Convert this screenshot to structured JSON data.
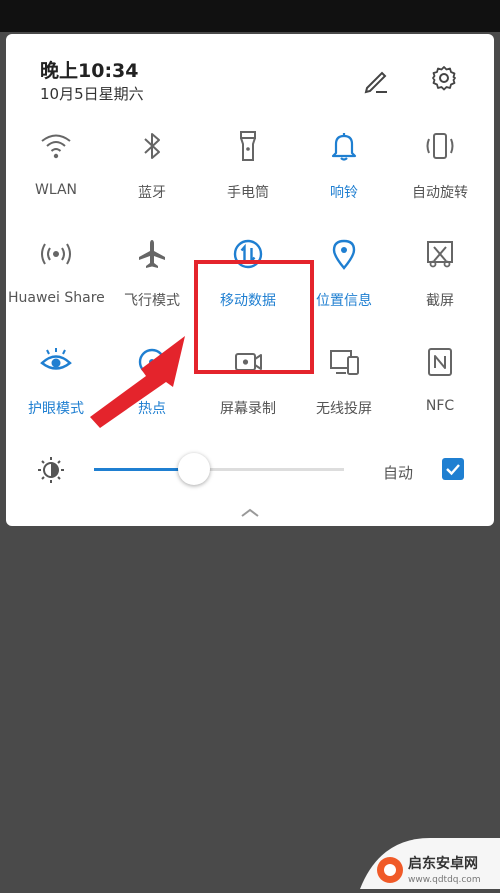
{
  "status": {
    "time": "晚上10:34",
    "date": "10月5日星期六"
  },
  "tiles": [
    {
      "label": "WLAN",
      "icon": "wifi-icon",
      "active": false
    },
    {
      "label": "蓝牙",
      "icon": "bluetooth-icon",
      "active": false
    },
    {
      "label": "手电筒",
      "icon": "flashlight-icon",
      "active": false
    },
    {
      "label": "响铃",
      "icon": "bell-icon",
      "active": true
    },
    {
      "label": "自动旋转",
      "icon": "auto-rotate-icon",
      "active": false
    },
    {
      "label": "Huawei Share",
      "icon": "huawei-share-icon",
      "active": false
    },
    {
      "label": "飞行模式",
      "icon": "airplane-icon",
      "active": false
    },
    {
      "label": "移动数据",
      "icon": "mobile-data-icon",
      "active": true
    },
    {
      "label": "位置信息",
      "icon": "location-icon",
      "active": true
    },
    {
      "label": "截屏",
      "icon": "screenshot-icon",
      "active": false
    },
    {
      "label": "护眼模式",
      "icon": "eye-icon",
      "active": true
    },
    {
      "label": "热点",
      "icon": "hotspot-icon",
      "active": true
    },
    {
      "label": "屏幕录制",
      "icon": "screen-record-icon",
      "active": false
    },
    {
      "label": "无线投屏",
      "icon": "cast-icon",
      "active": false
    },
    {
      "label": "NFC",
      "icon": "nfc-icon",
      "active": false
    }
  ],
  "brightness": {
    "level": 0.4,
    "auto_label": "自动",
    "auto_checked": true
  },
  "colors": {
    "accent": "#1f7fd1",
    "highlight": "#e4242c",
    "inactive": "#555555"
  },
  "watermark": {
    "name": "启东安卓网",
    "url": "www.qdtdq.com"
  }
}
